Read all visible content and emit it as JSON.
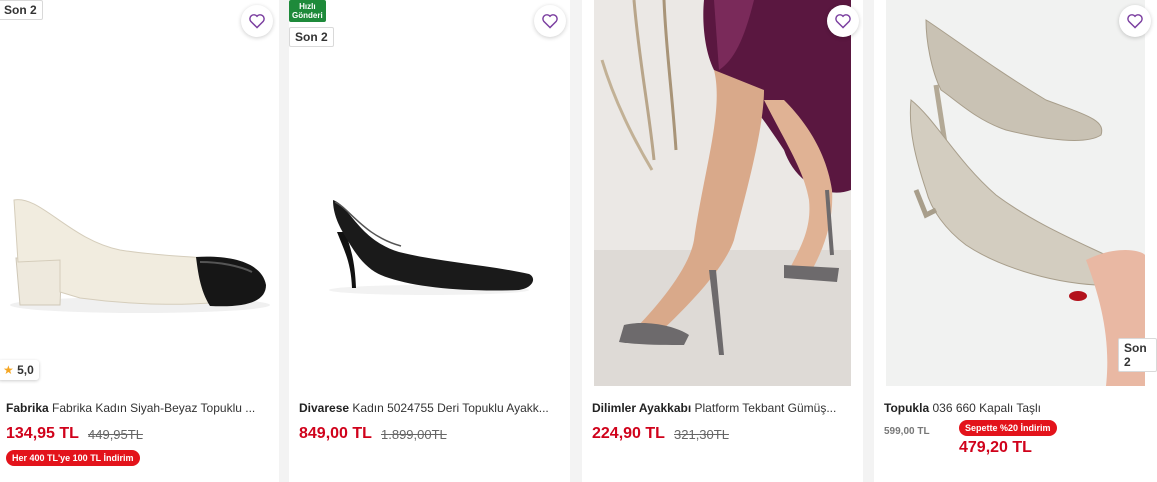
{
  "colors": {
    "price": "#d0021b",
    "promo": "#e3131b",
    "fast": "#1e8a3a",
    "heart": "#7b3fa0"
  },
  "products": [
    {
      "stock_badge": "Son 2",
      "rating": "5,0",
      "brand": "Fabrika",
      "name": "Fabrika Kadın Siyah-Beyaz Topuklu ...",
      "price": "134,95 TL",
      "old_price": "449,95TL",
      "promo": "Her 400 TL'ye 100 TL İndirim",
      "image": "cream-black-block-heel-pump"
    },
    {
      "fast_badge_line1": "Hızlı",
      "fast_badge_line2": "Gönderi",
      "stock_badge": "Son 2",
      "brand": "Divarese",
      "name": "Kadın 5024755 Deri Topuklu Ayakk...",
      "price": "849,00 TL",
      "old_price": "1.899,00TL",
      "image": "black-kitten-heel-pump"
    },
    {
      "brand": "Dilimler Ayakkabı",
      "name": "Platform Tekbant Gümüş...",
      "price": "224,90 TL",
      "old_price": "321,30TL",
      "image": "metallic-strappy-heel-sandal"
    },
    {
      "stock_badge": "Son 2",
      "brand": "Topukla",
      "name": "036 660 Kapalı Taşlı",
      "small_old_price": "599,00 TL",
      "promo": "Sepette %20 İndirim",
      "price": "479,20 TL",
      "image": "silver-rhinestone-pump"
    }
  ]
}
